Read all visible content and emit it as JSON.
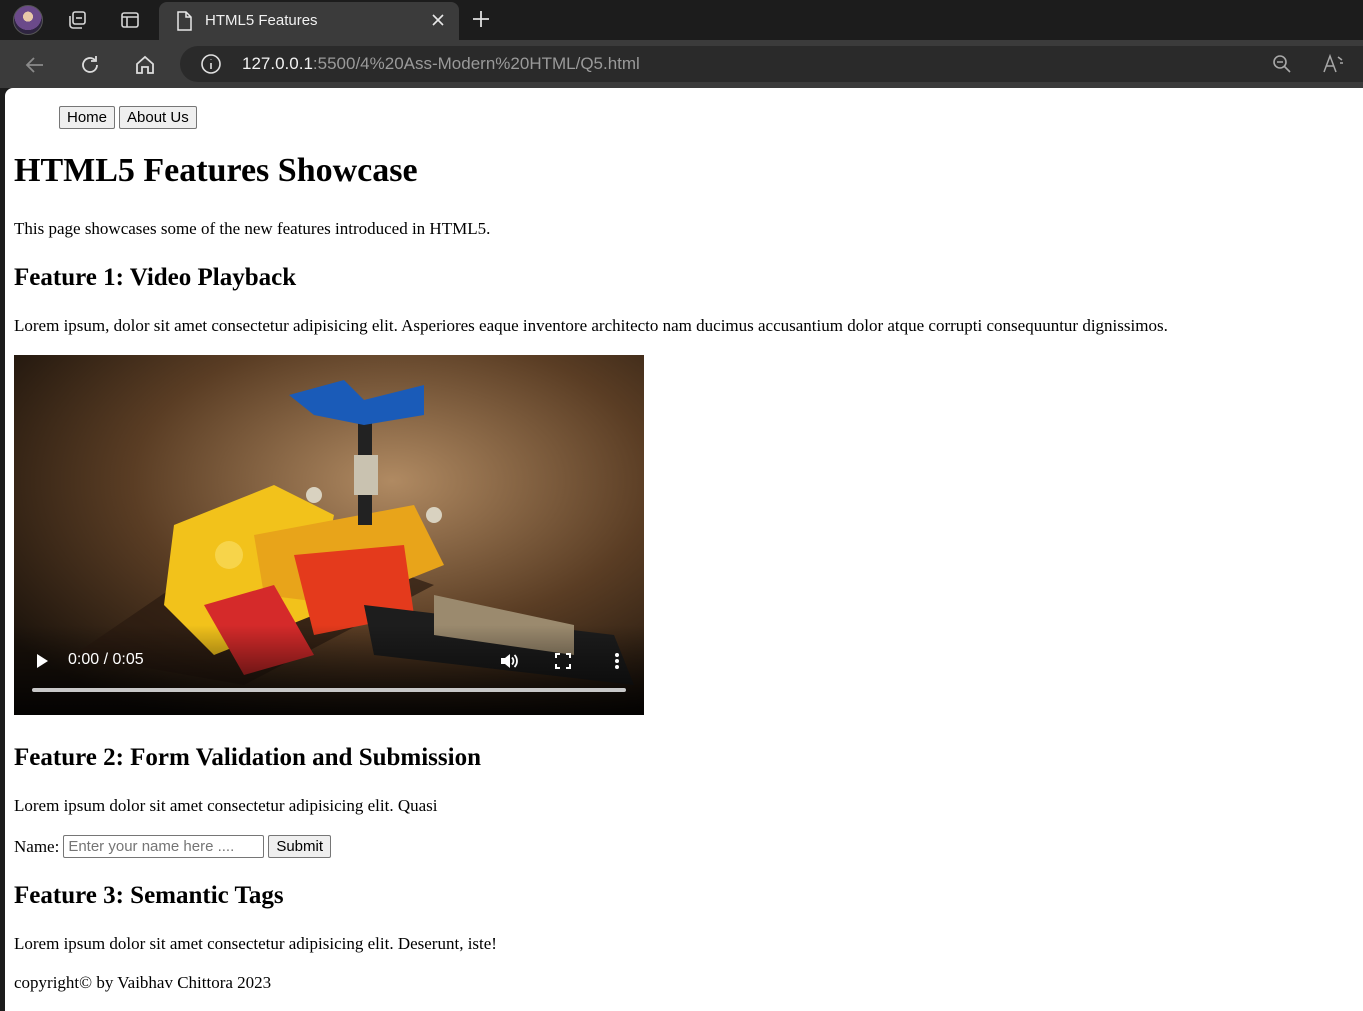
{
  "browser": {
    "tab_title": "HTML5 Features",
    "url_host": "127.0.0.1",
    "url_rest": ":5500/4%20Ass-Modern%20HTML/Q5.html"
  },
  "nav": {
    "home_label": "Home",
    "about_label": "About Us"
  },
  "page": {
    "title": "HTML5 Features Showcase",
    "intro": "This page showcases some of the new features introduced in HTML5.",
    "feature1": {
      "heading": "Feature 1: Video Playback",
      "text": "Lorem ipsum, dolor sit amet consectetur adipisicing elit. Asperiores eaque inventore architecto nam ducimus accusantium dolor atque corrupti consequuntur dignissimos."
    },
    "video": {
      "time": "0:00 / 0:05",
      "progress": 0
    },
    "feature2": {
      "heading": "Feature 2: Form Validation and Submission",
      "text": "Lorem ipsum dolor sit amet consectetur adipisicing elit. Quasi",
      "name_label": "Name:",
      "name_placeholder": "Enter your name here ....",
      "submit_label": "Submit"
    },
    "feature3": {
      "heading": "Feature 3: Semantic Tags",
      "text": "Lorem ipsum dolor sit amet consectetur adipisicing elit. Deserunt, iste!"
    },
    "footer": "copyright© by Vaibhav Chittora 2023"
  }
}
